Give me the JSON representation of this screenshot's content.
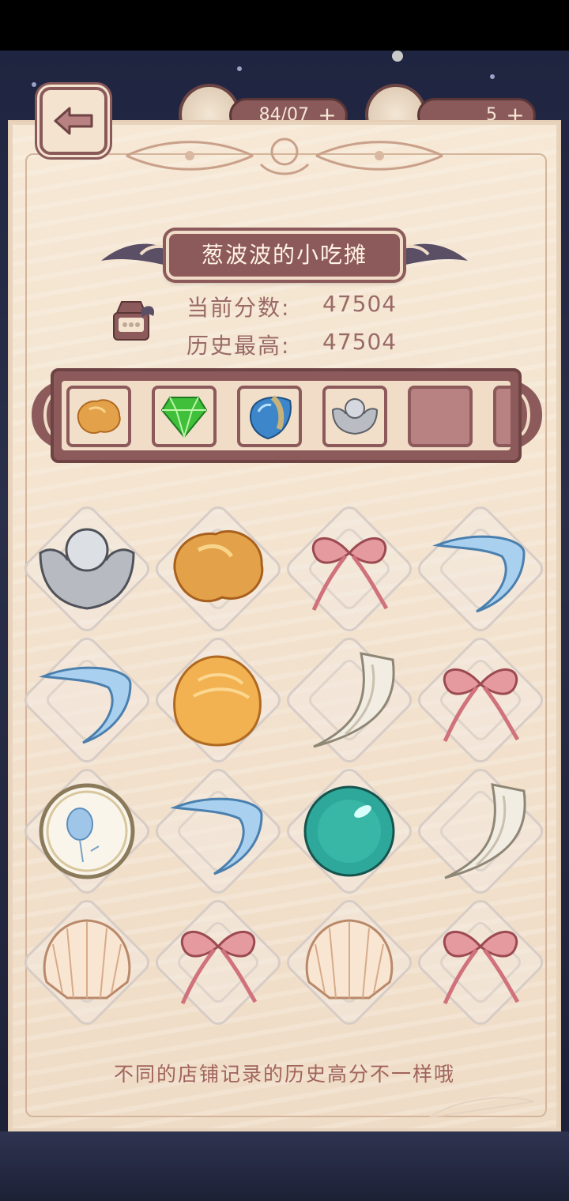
{
  "header": {
    "back_label": "",
    "resource1_value": "84/07",
    "resource2_value": "5"
  },
  "title": "葱波波的小吃摊",
  "score": {
    "current_label": "当前分数:",
    "current_value": "47504",
    "best_label": "历史最高:",
    "best_value": "47504"
  },
  "collected_slots": [
    {
      "icon": "gold-nugget-icon"
    },
    {
      "icon": "green-gem-icon"
    },
    {
      "icon": "blue-stone-icon"
    },
    {
      "icon": "silver-ingot-icon"
    },
    {
      "icon": "empty-slot"
    }
  ],
  "grid": [
    [
      "silver-ingot-icon",
      "gold-nugget-icon",
      "pink-ribbon-icon",
      "blue-feather-icon"
    ],
    [
      "blue-feather-icon",
      "orange-bun-icon",
      "white-claw-icon",
      "pink-ribbon-icon"
    ],
    [
      "balloon-badge-icon",
      "blue-feather-icon",
      "teal-pearl-icon",
      "white-claw-icon"
    ],
    [
      "scallop-shell-icon",
      "pink-ribbon-icon",
      "scallop-shell-icon",
      "pink-ribbon-icon"
    ]
  ],
  "hint_text": "不同的店铺记录的历史高分不一样哦",
  "colors": {
    "panel": "#f5e6d3",
    "accent": "#8c5a5a",
    "text": "#9a6a66",
    "hint": "#a0645c"
  }
}
